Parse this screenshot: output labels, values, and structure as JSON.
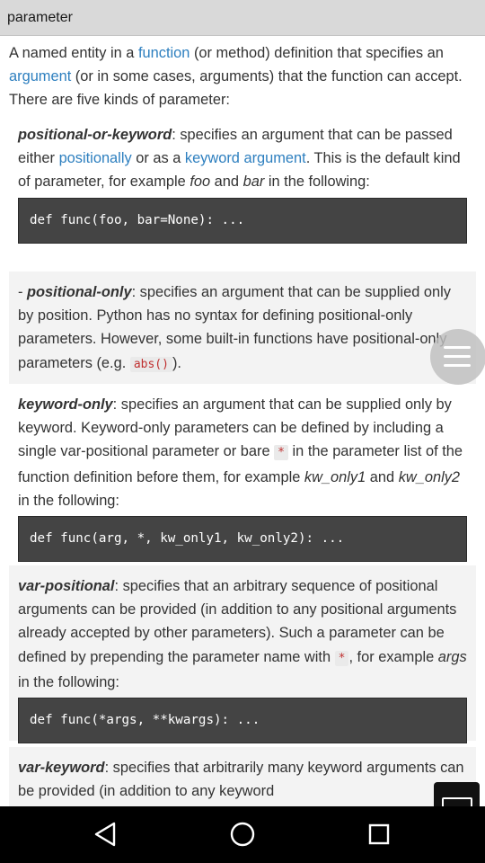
{
  "header": {
    "title": "parameter"
  },
  "intro": {
    "t1": "A named entity in a ",
    "link1": "function",
    "t2": " (or method) definition that specifies an ",
    "link2": "argument",
    "t3": " (or in some cases, arguments) that the function can accept. There are five kinds of parameter:"
  },
  "items": {
    "positional_or_keyword": {
      "term": "positional-or-keyword",
      "t1": ": specifies an argument that can be passed either ",
      "link1": "positionally",
      "t2": " or as a ",
      "link2": "keyword argument",
      "t3": ". This is the default kind of parameter, for example ",
      "em1": "foo",
      "t4": " and ",
      "em2": "bar",
      "t5": " in the following:",
      "code": "def func(foo, bar=None): ..."
    },
    "positional_only": {
      "dash": "- ",
      "term": "positional-only",
      "t1": ": specifies an argument that can be supplied only by position. Python has no syntax for defining positional-only parameters. However, some built-in functions have positional-only parameters (e.g. ",
      "code_inline": "abs()",
      "t2": ")."
    },
    "keyword_only": {
      "term": "keyword-only",
      "t1": ": specifies an argument that can be supplied only by keyword. Keyword-only parameters can be defined by including a single var-positional parameter or bare ",
      "code_inline": "*",
      "t2": " in the parameter list of the function definition before them, for example ",
      "em1": "kw_only1",
      "t3": " and ",
      "em2": "kw_only2",
      "t4": " in the following:",
      "code": "def func(arg, *, kw_only1, kw_only2): ..."
    },
    "var_positional": {
      "term": "var-positional",
      "t1": ": specifies that an arbitrary sequence of positional arguments can be provided (in addition to any positional arguments already accepted by other parameters). Such a parameter can be defined by prepending the parameter name with ",
      "code_inline": "*",
      "t2": ", for example ",
      "em1": "args",
      "t3": " in the following:",
      "code": "def func(*args, **kwargs): ..."
    },
    "var_keyword": {
      "term": "var-keyword",
      "t1": ": specifies that arbitrarily many keyword arguments can be provided (in addition to any keyword"
    }
  },
  "icons": {
    "menu": "hamburger-menu-icon",
    "window": "window-icon",
    "back": "back-triangle-icon",
    "home": "home-circle-icon",
    "recents": "recents-square-icon"
  },
  "colors": {
    "link": "#2d7fbf",
    "code_bg": "#444444",
    "inline_code": "#c03030",
    "header_bg": "#d9d9d9"
  }
}
